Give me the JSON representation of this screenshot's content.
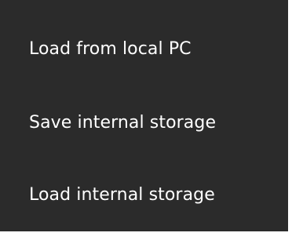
{
  "menu": {
    "items": [
      {
        "label": "Load from local PC"
      },
      {
        "label": "Save internal storage"
      },
      {
        "label": "Load internal storage"
      }
    ]
  },
  "colors": {
    "menu_background": "#2b2b2b",
    "text": "#ffffff",
    "page_background": "#ffffff"
  }
}
